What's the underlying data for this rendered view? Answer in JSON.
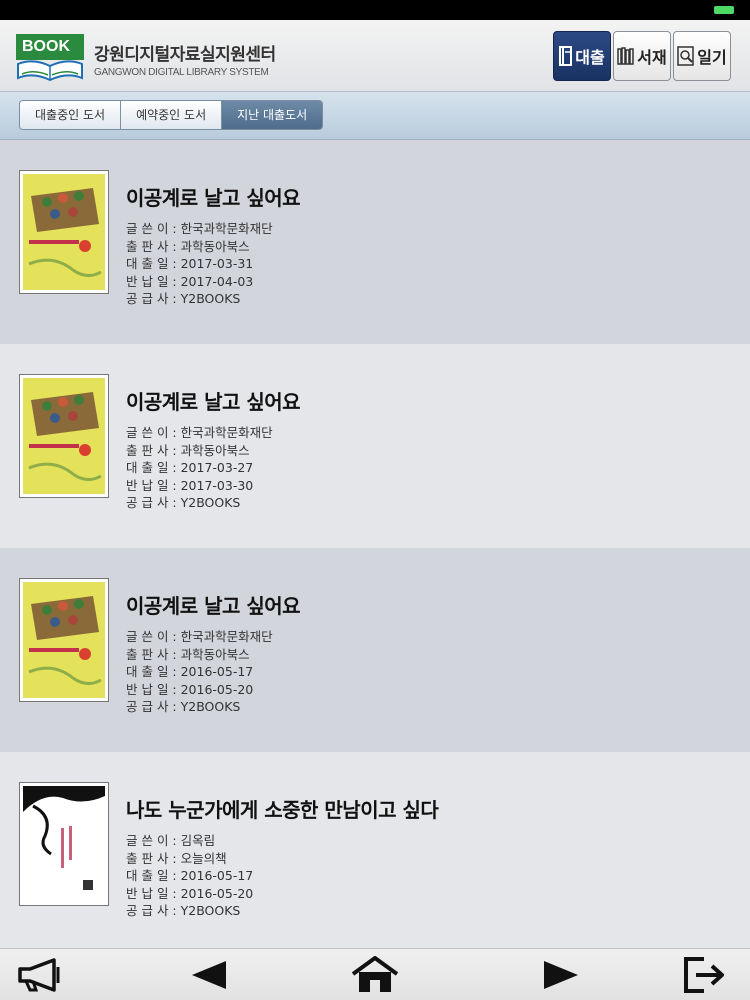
{
  "header": {
    "logo_text": "BOOK",
    "title": "강원디지털자료실지원센터",
    "subtitle": "GANGWON DIGITAL LIBRARY SYSTEM",
    "buttons": [
      {
        "label": "대출",
        "icon": "book-icon",
        "active": true
      },
      {
        "label": "서재",
        "icon": "bookshelf-icon",
        "active": false
      },
      {
        "label": "일기",
        "icon": "search-doc-icon",
        "active": false
      }
    ]
  },
  "tabs": [
    {
      "label": "대출중인 도서",
      "active": false
    },
    {
      "label": "예약중인 도서",
      "active": false
    },
    {
      "label": "지난 대출도서",
      "active": true
    }
  ],
  "field_labels": {
    "author": "글 쓴 이 : ",
    "publisher": "출 판 사 : ",
    "loan_date": "대 출 일 : ",
    "return_date": "반 납 일 : ",
    "supplier": "공 급 사 : "
  },
  "books": [
    {
      "title": "이공계로 날고 싶어요",
      "author": "한국과학문화재단",
      "publisher": "과학동아북스",
      "loan_date": "2017-03-31",
      "return_date": "2017-04-03",
      "supplier": "Y2BOOKS",
      "cover": "yellow"
    },
    {
      "title": "이공계로 날고 싶어요",
      "author": "한국과학문화재단",
      "publisher": "과학동아북스",
      "loan_date": "2017-03-27",
      "return_date": "2017-03-30",
      "supplier": "Y2BOOKS",
      "cover": "yellow"
    },
    {
      "title": "이공계로 날고 싶어요",
      "author": "한국과학문화재단",
      "publisher": "과학동아북스",
      "loan_date": "2016-05-17",
      "return_date": "2016-05-20",
      "supplier": "Y2BOOKS",
      "cover": "yellow"
    },
    {
      "title": "나도 누군가에게 소중한 만남이고 싶다",
      "author": "김옥림",
      "publisher": "오늘의책",
      "loan_date": "2016-05-17",
      "return_date": "2016-05-20",
      "supplier": "Y2BOOKS",
      "cover": "white"
    }
  ],
  "bottom_nav": [
    {
      "icon": "megaphone-icon"
    },
    {
      "icon": "back-arrow-icon"
    },
    {
      "icon": "home-icon"
    },
    {
      "icon": "forward-arrow-icon"
    },
    {
      "icon": "logout-icon"
    }
  ],
  "colors": {
    "accent": "#1a3263",
    "logo_green": "#2a8a3e",
    "tab_active": "#5a7898"
  }
}
